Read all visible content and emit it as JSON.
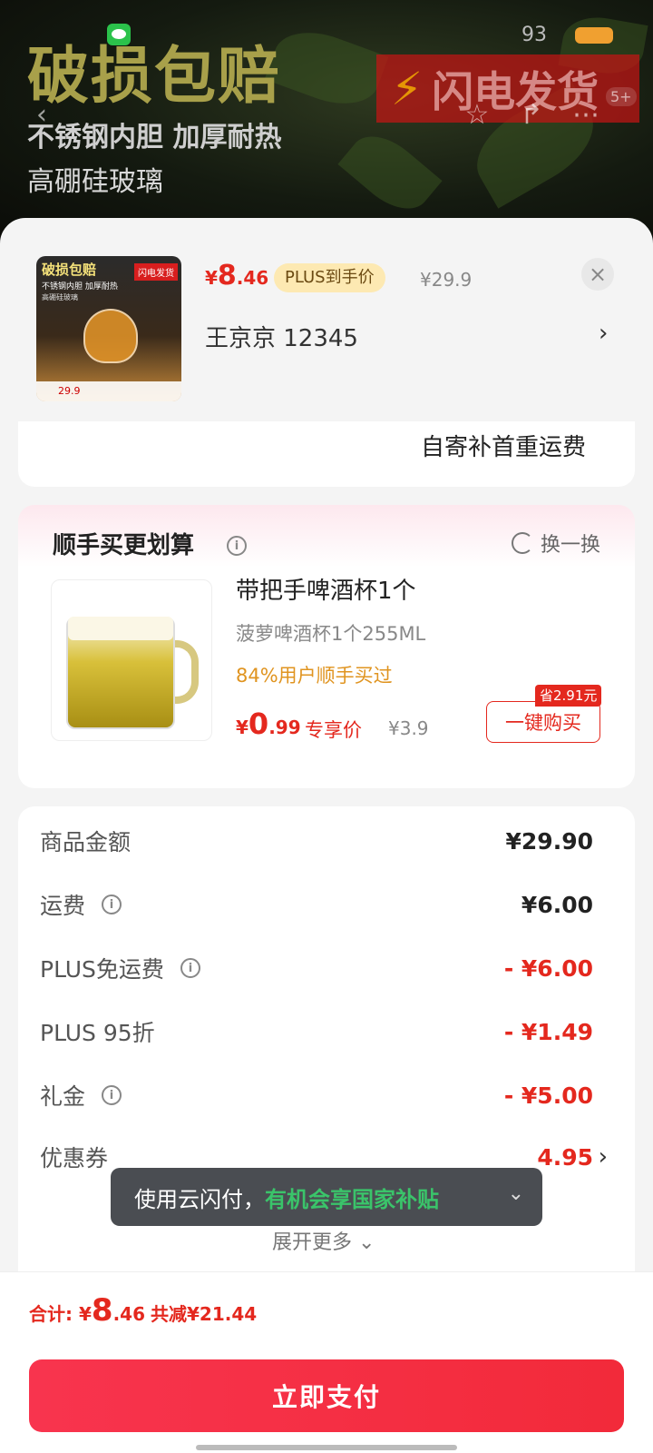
{
  "banner": {
    "title": "破损包赔",
    "sub1": "不锈钢内胆 加厚耐热",
    "sub2": "高硼硅玻璃",
    "flash": "闪电发货",
    "status_time": "93",
    "notif_count": "5+"
  },
  "product": {
    "thumb_title": "破损包赔",
    "thumb_sub": "不锈钢内胆 加厚耐热",
    "thumb_sub2": "高硼硅玻璃",
    "thumb_flash": "闪电发货",
    "thumb_price": "29.9",
    "price_sym": "¥",
    "price_int": "8",
    "price_dec": ".46",
    "plus_tag": "PLUS到手价",
    "price_orig": "¥29.9",
    "address": "王京京  12345"
  },
  "shipping_note": "自寄补首重运费",
  "addon": {
    "title": "顺手买更划算",
    "swap_label": "换一换",
    "item_title": "带把手啤酒杯1个",
    "item_spec": "菠萝啤酒杯1个255ML",
    "item_stat": "84%用户顺手买过",
    "price_sym": "¥",
    "price_int": "0",
    "price_dec": ".99",
    "price_label": "专享价",
    "price_orig": "¥3.9",
    "save_tag": "省2.91元",
    "buy_label": "一键购买"
  },
  "summary": {
    "rows": [
      {
        "label": "商品金额",
        "value": "¥29.90"
      },
      {
        "label": "运费",
        "value": "¥6.00"
      },
      {
        "label": "PLUS免运费",
        "value": "- ¥6.00"
      },
      {
        "label": "PLUS 95折",
        "value": "- ¥1.49"
      },
      {
        "label": "礼金",
        "value": "- ¥5.00"
      },
      {
        "label": "优惠券",
        "value": "4.95"
      }
    ],
    "expand_label": "展开更多"
  },
  "toast": {
    "text": "使用云闪付，",
    "highlight": "有机会享国家补贴"
  },
  "bottom": {
    "total_label": "合计: ",
    "total_sym": "¥",
    "total_int": "8",
    "total_dec": ".46",
    "total_save": "共减¥21.44",
    "pay_label": "立即支付"
  },
  "colors": {
    "accent_red": "#e4281e",
    "pay_button": "#f8344e",
    "highlight_green": "#3ac46a",
    "plus_tag_bg": "#fde9b2"
  },
  "icons": [
    "wechat-icon",
    "back-icon",
    "star-icon",
    "share-icon",
    "more-icon",
    "close-icon",
    "chevron-right-icon",
    "info-icon",
    "swap-icon",
    "chevron-down-icon"
  ]
}
